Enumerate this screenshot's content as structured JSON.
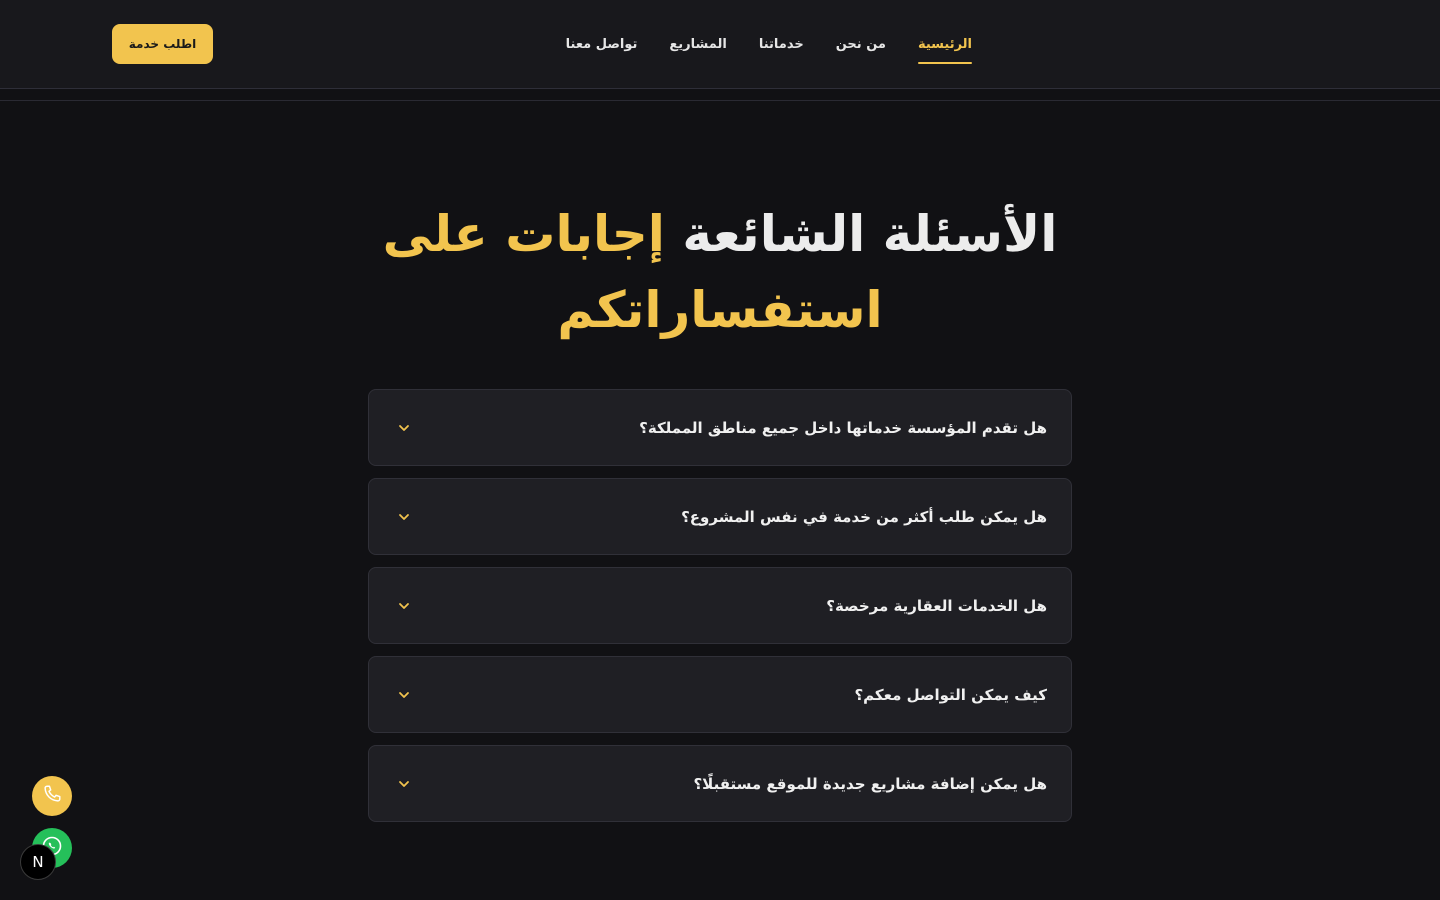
{
  "nav": {
    "items": [
      {
        "label": "الرئيسية",
        "active": true
      },
      {
        "label": "من نحن",
        "active": false
      },
      {
        "label": "خدماتنا",
        "active": false
      },
      {
        "label": "المشاريع",
        "active": false
      },
      {
        "label": "تواصل معنا",
        "active": false
      }
    ],
    "cta_label": "اطلب خدمة"
  },
  "hero": {
    "title_white": "الأسئلة الشائعة",
    "title_gold": "إجابات على استفساراتكم"
  },
  "faq": [
    {
      "question": "هل تقدم المؤسسة خدماتها داخل جميع مناطق المملكة؟"
    },
    {
      "question": "هل يمكن طلب أكثر من خدمة في نفس المشروع؟"
    },
    {
      "question": "هل الخدمات العقارية مرخصة؟"
    },
    {
      "question": "كيف يمكن التواصل معكم؟"
    },
    {
      "question": "هل يمكن إضافة مشاريع جديدة للموقع مستقبلًا؟"
    }
  ],
  "floating": {
    "next_badge": "N"
  },
  "colors": {
    "accent": "#f2c44e",
    "background": "#111114",
    "card": "#1f1f24",
    "whatsapp": "#25c05a"
  },
  "icons": {
    "chevron": "chevron-down-icon",
    "phone": "phone-icon",
    "whatsapp": "whatsapp-icon"
  }
}
